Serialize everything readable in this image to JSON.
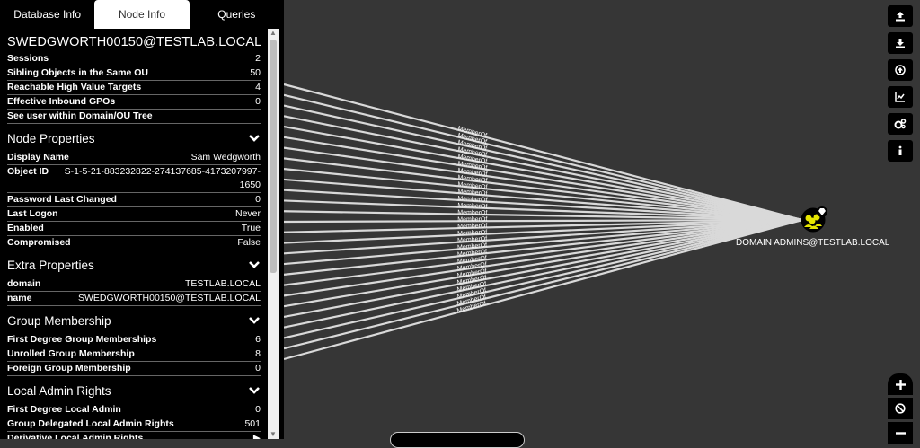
{
  "tabs": [
    {
      "label": "Database Info"
    },
    {
      "label": "Node Info"
    },
    {
      "label": "Queries"
    }
  ],
  "node_title": "SWEDGWORTH00150@TESTLAB.LOCAL",
  "summary": [
    {
      "key": "Sessions",
      "value": "2"
    },
    {
      "key": "Sibling Objects in the Same OU",
      "value": "50"
    },
    {
      "key": "Reachable High Value Targets",
      "value": "4"
    },
    {
      "key": "Effective Inbound GPOs",
      "value": "0"
    },
    {
      "key": "See user within Domain/OU Tree",
      "value": ""
    }
  ],
  "node_properties": {
    "title": "Node Properties",
    "rows": [
      {
        "key": "Display Name",
        "value": "Sam Wedgworth"
      },
      {
        "key": "Object ID",
        "value": "S-1-5-21-883232822-274137685-4173207997-1650"
      },
      {
        "key": "Password Last Changed",
        "value": "0"
      },
      {
        "key": "Last Logon",
        "value": "Never"
      },
      {
        "key": "Enabled",
        "value": "True"
      },
      {
        "key": "Compromised",
        "value": "False"
      }
    ]
  },
  "extra_properties": {
    "title": "Extra Properties",
    "rows": [
      {
        "key": "domain",
        "value": "TESTLAB.LOCAL"
      },
      {
        "key": "name",
        "value": "SWEDGWORTH00150@TESTLAB.LOCAL"
      }
    ]
  },
  "group_membership": {
    "title": "Group Membership",
    "rows": [
      {
        "key": "First Degree Group Memberships",
        "value": "6"
      },
      {
        "key": "Unrolled Group Membership",
        "value": "8"
      },
      {
        "key": "Foreign Group Membership",
        "value": "0"
      }
    ]
  },
  "local_admin": {
    "title": "Local Admin Rights",
    "rows": [
      {
        "key": "First Degree Local Admin",
        "value": "0"
      },
      {
        "key": "Group Delegated Local Admin Rights",
        "value": "501"
      },
      {
        "key": "Derivative Local Admin Rights",
        "value": "▶"
      }
    ]
  },
  "graph": {
    "edge_label": "MemberOf",
    "target_node": "DOMAIN ADMINS@TESTLAB.LOCAL",
    "edge_count": 27
  },
  "toolbar_icons": [
    "upload-icon",
    "download-icon",
    "import-icon",
    "chart-icon",
    "settings-icon",
    "info-icon"
  ],
  "zoom_icons": [
    "zoom-in-icon",
    "reset-icon",
    "zoom-out-icon"
  ],
  "colors": {
    "canvas": "#363636",
    "panel": "#000000",
    "edge": "#d9d9d9",
    "node": "#e6e600"
  }
}
